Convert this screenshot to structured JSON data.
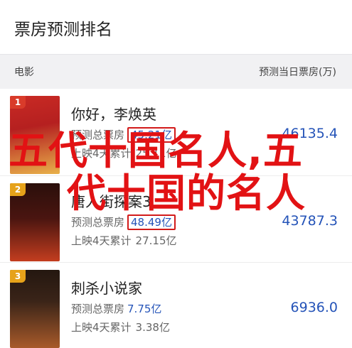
{
  "header": {
    "title": "票房预测排名"
  },
  "subheader": {
    "left": "电影",
    "right": "预测当日票房(万)"
  },
  "movies": [
    {
      "rank": "1",
      "title": "你好，李焕英",
      "predict_label": "预测总票房",
      "predict_value": "45.21亿",
      "released_label": "上映4天累计",
      "released_value": "25.11亿",
      "today_value": "46135.4",
      "poster_colors": [
        "#b52020",
        "#e8b14a"
      ]
    },
    {
      "rank": "2",
      "title": "唐人街探案3",
      "predict_label": "预测总票房",
      "predict_value": "48.49亿",
      "released_label": "上映4天累计",
      "released_value": "27.15亿",
      "today_value": "43787.3",
      "poster_colors": [
        "#4a1510",
        "#c33d1f"
      ]
    },
    {
      "rank": "3",
      "title": "刺杀小说家",
      "predict_label": "预测总票房",
      "predict_value": "7.75亿",
      "released_label": "上映4天累计",
      "released_value": "3.38亿",
      "today_value": "6936.0",
      "poster_colors": [
        "#3a2418",
        "#a85a2a"
      ]
    }
  ],
  "watermark": {
    "line1": "五代十国名人,五",
    "line2": "代十国的名人"
  },
  "colors": {
    "accent_blue": "#2453b8",
    "highlight_red": "#d21a1a",
    "watermark_red": "#e21214",
    "badge_gold": "#e6a21a"
  }
}
